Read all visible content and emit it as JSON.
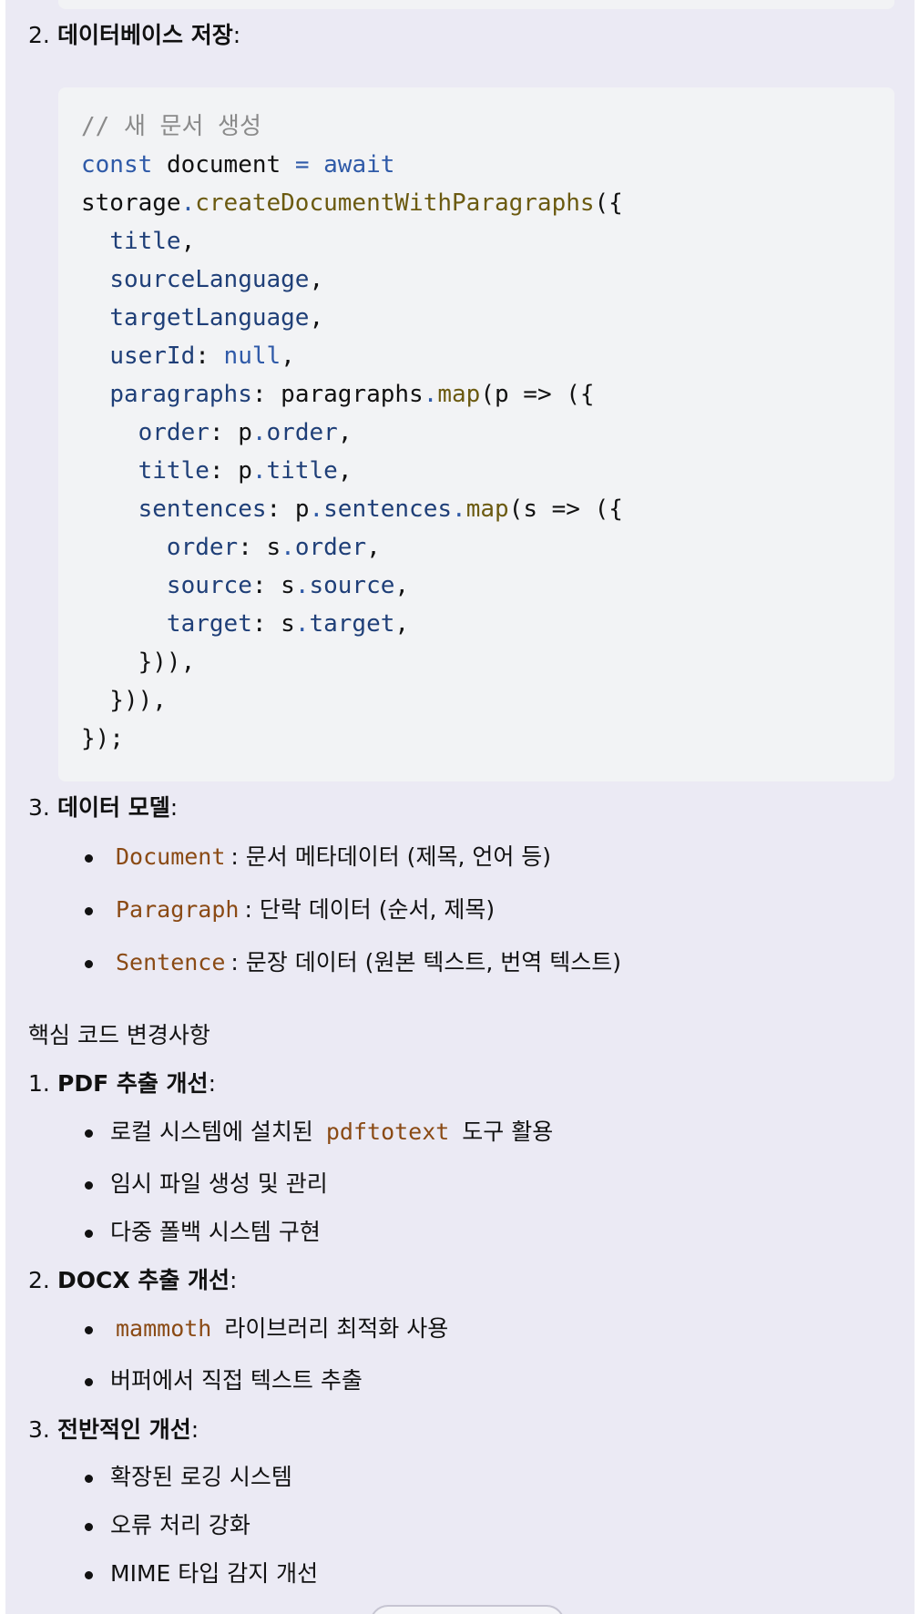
{
  "doc": {
    "section_storage": {
      "number": "2.",
      "title": "데이터베이스 저장",
      "suffix": ":"
    },
    "code": {
      "comment": "// 새 문서 생성",
      "kw_const": "const",
      "ident_document": "document",
      "op_eq": "=",
      "kw_await": "await",
      "obj_storage": "storage",
      "fn_create": "createDocumentWithParagraphs",
      "prop_title": "title",
      "prop_sourceLanguage": "sourceLanguage",
      "prop_targetLanguage": "targetLanguage",
      "prop_userId": "userId",
      "kw_null": "null",
      "prop_paragraphs": "paragraphs",
      "ident_paragraphs": "paragraphs",
      "fn_map": "map",
      "param_p": "p",
      "prop_order": "order",
      "prop_sentences": "sentences",
      "param_s": "s",
      "prop_source": "source",
      "prop_target": "target"
    },
    "section_model": {
      "number": "3.",
      "title": "데이터 모델",
      "suffix": ":",
      "items": [
        {
          "code": "Document",
          "text": ": 문서 메타데이터 (제목, 언어 등)"
        },
        {
          "code": "Paragraph",
          "text": ": 단락 데이터 (순서, 제목)"
        },
        {
          "code": "Sentence",
          "text": ": 문장 데이터 (원본 텍스트, 번역 텍스트)"
        }
      ]
    },
    "changes_heading": "핵심 코드 변경사항",
    "changes": [
      {
        "number": "1.",
        "title": "PDF 추출 개선",
        "suffix": ":",
        "items": [
          {
            "before": "로컬 시스템에 설치된",
            "code": "pdftotext",
            "after": "도구 활용"
          },
          {
            "text": "임시 파일 생성 및 관리"
          },
          {
            "text": "다중 폴백 시스템 구현"
          }
        ]
      },
      {
        "number": "2.",
        "title": "DOCX 추출 개선",
        "suffix": ":",
        "items": [
          {
            "code": "mammoth",
            "after": "라이브러리 최적화 사용"
          },
          {
            "text": "버퍼에서 직접 텍스트 추출"
          }
        ]
      },
      {
        "number": "3.",
        "title": "전반적인 개선",
        "suffix": ":",
        "items": [
          {
            "text": "확장된 로깅 시스템"
          },
          {
            "text": "오류 처리 강화"
          },
          {
            "text": "MIME 타입 감지 개선"
          }
        ]
      }
    ]
  }
}
